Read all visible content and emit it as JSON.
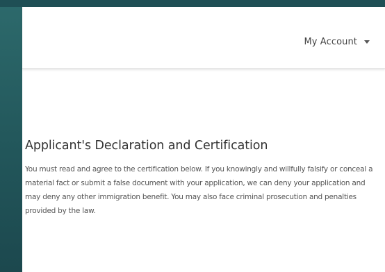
{
  "header": {
    "account_label": "My Account"
  },
  "declaration": {
    "title": "Applicant's Declaration and Certification",
    "body": "You must read and agree to the certification below. If you knowingly and willfully falsify or conceal a material fact or submit a false document with your application, we can deny your application and may deny any other immigration benefit. You may also face criminal prosecution and penalties provided by the law."
  },
  "colors": {
    "background": "#1f4f55",
    "panel": "#ffffff",
    "title_text": "#333333",
    "body_text": "#555555"
  },
  "icons": {
    "account_dropdown": "caret-down-icon"
  }
}
